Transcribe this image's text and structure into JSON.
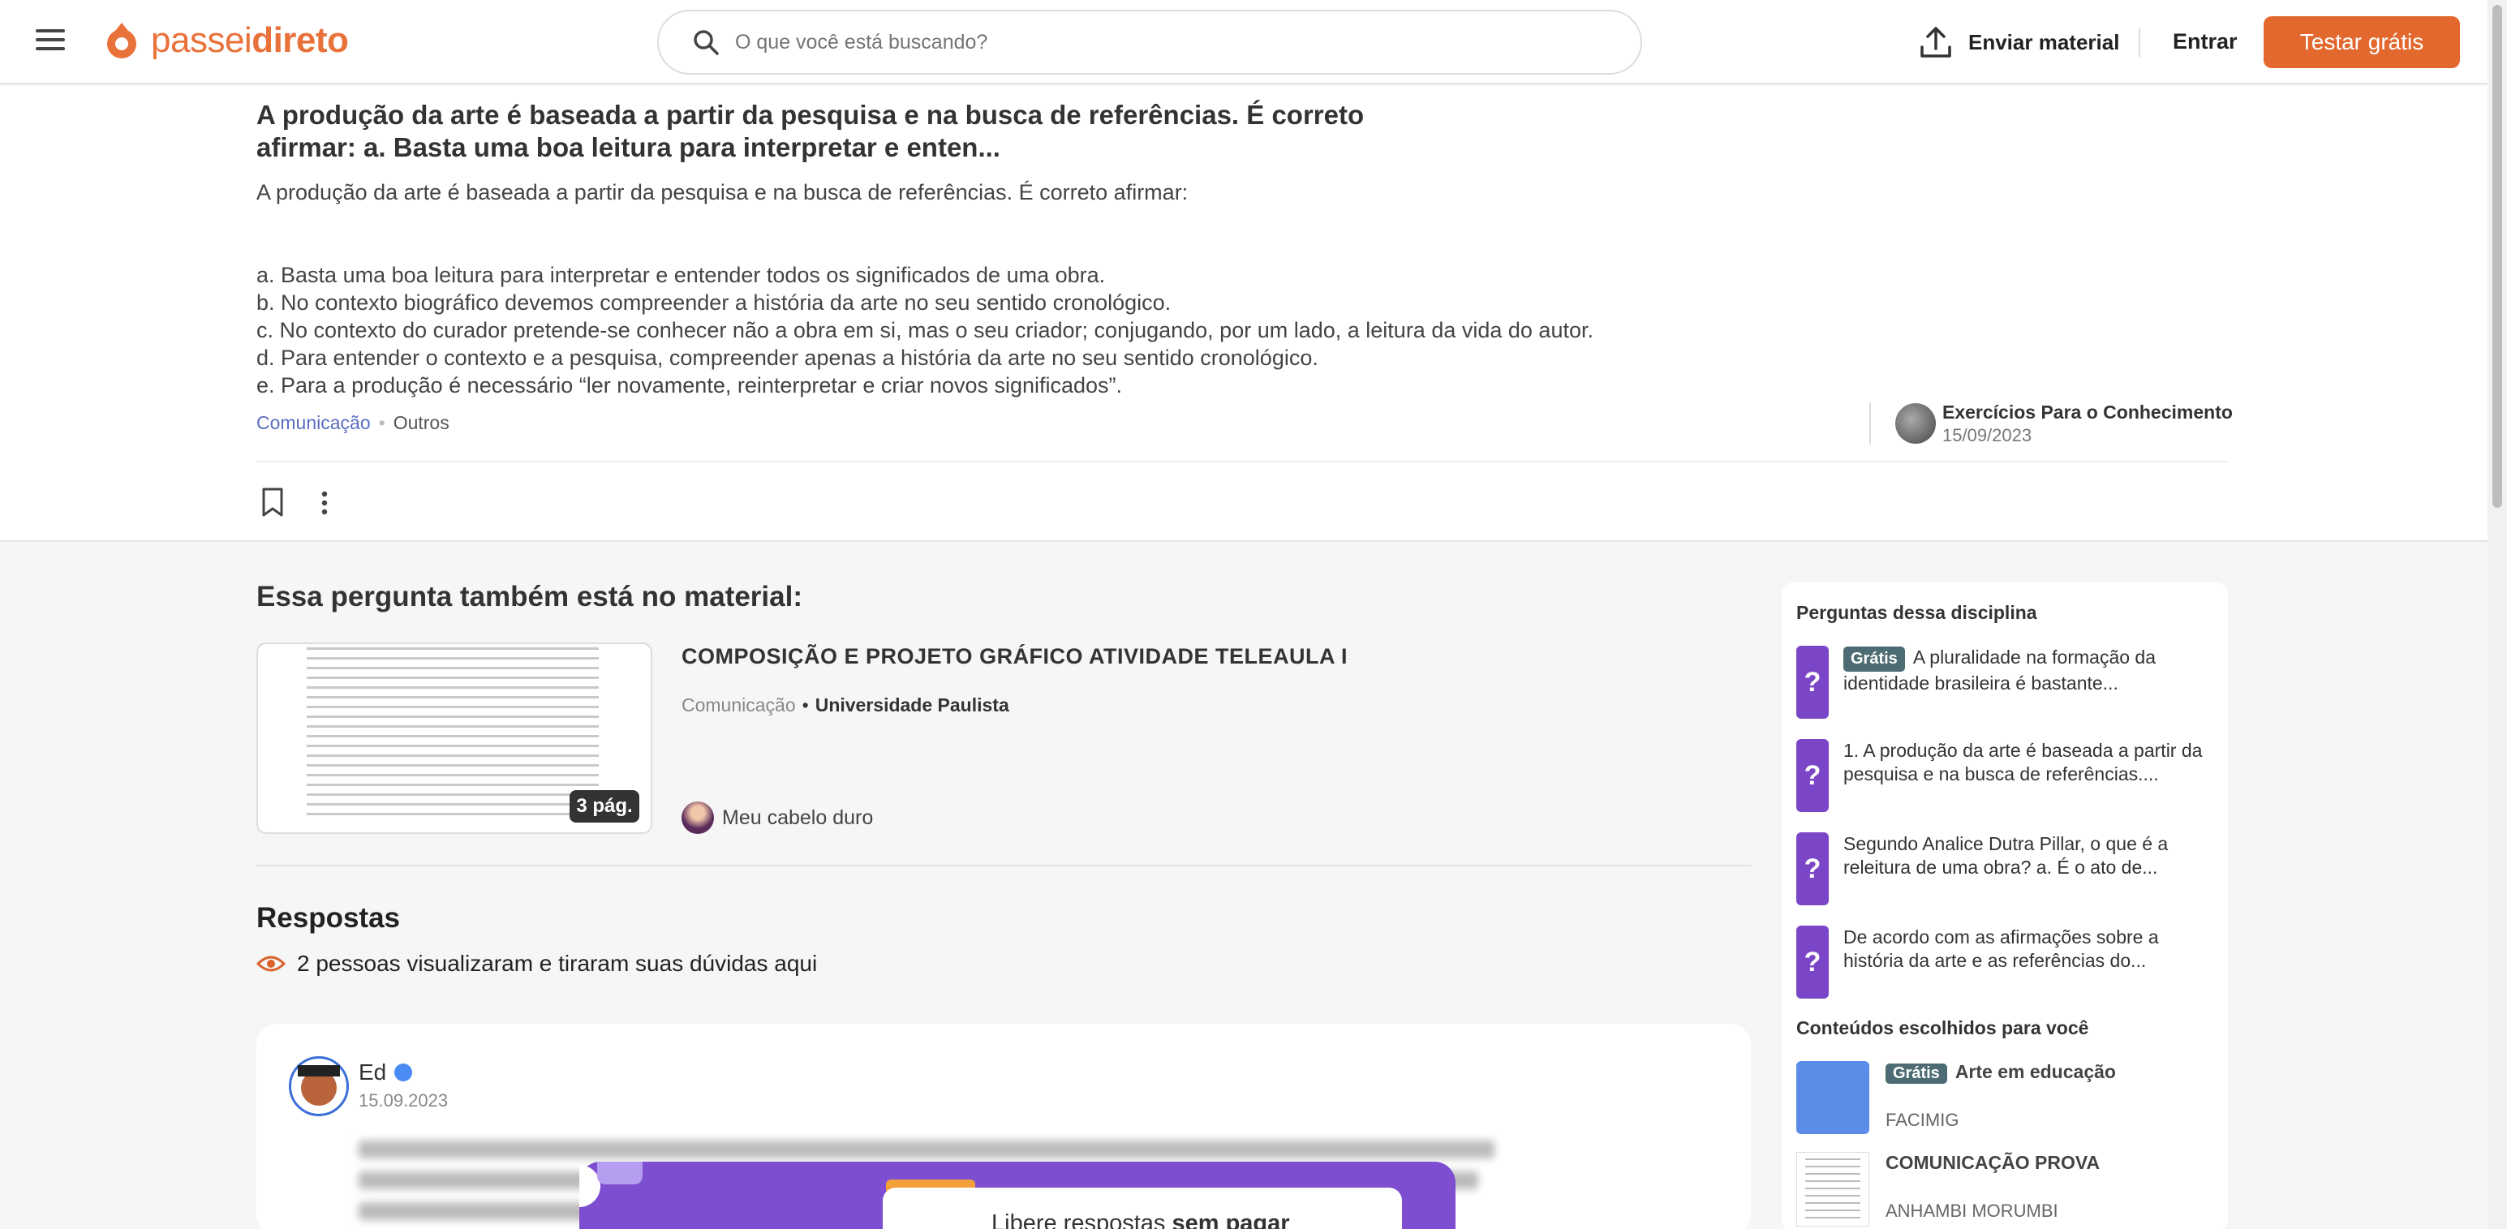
{
  "header": {
    "logo": {
      "part1": "passei",
      "part2": "direto"
    },
    "search_placeholder": "O que você está buscando?",
    "upload_label": "Enviar material",
    "login_label": "Entrar",
    "trial_label": "Testar grátis",
    "accent_color": "#e2682d"
  },
  "question": {
    "title": "A produção da arte é baseada a partir da pesquisa e na busca de referências. É correto afirmar: a. Basta uma boa leitura para interpretar e enten...",
    "intro": "A produção da arte é baseada a partir da pesquisa e na busca de referências. É correto afirmar:",
    "options": [
      "a. Basta uma boa leitura para interpretar e entender todos os significados de uma obra.",
      "b. No contexto biográfico devemos compreender a história da arte no seu sentido cronológico.",
      "c. No contexto do curador pretende-se conhecer não a obra em si, mas o seu criador; conjugando, por um lado, a leitura da vida do autor.",
      "d. Para entender o contexto e a pesquisa, compreender apenas a história da arte no seu sentido cronológico.",
      "e. Para a produção é necessário “ler novamente, reinterpretar e criar novos significados”."
    ],
    "tag_subject": "Comunicação",
    "tag_other": "Outros",
    "author_name": "Exercícios Para o Conhecimento",
    "author_date": "15/09/2023"
  },
  "material": {
    "section_title": "Essa pergunta também está no material:",
    "pages_badge": "3 pág.",
    "title": "COMPOSIÇÃO E PROJETO GRÁFICO ATIVIDADE TELEAULA I",
    "subject": "Comunicação",
    "separator": "•",
    "university": "Universidade Paulista",
    "author": "Meu cabelo duro"
  },
  "answers": {
    "title": "Respostas",
    "views_text": "2 pessoas visualizaram e tiraram suas dúvidas aqui",
    "answer_author": "Ed",
    "answer_date": "15.09.2023",
    "paywall_text_prefix": "Libere respostas ",
    "paywall_text_bold": "sem pagar"
  },
  "sidebar": {
    "questions_heading": "Perguntas dessa disciplina",
    "free_badge": "Grátis",
    "questions": [
      {
        "free": true,
        "text": "A pluralidade na formação da identidade brasileira é bastante..."
      },
      {
        "free": false,
        "text": "1. A produção da arte é baseada a partir da pesquisa e na busca de referências...."
      },
      {
        "free": false,
        "text": "Segundo Analice Dutra Pillar, o que é a releitura de uma obra? a. É o ato de..."
      },
      {
        "free": false,
        "text": "De acordo com as afirmações sobre a história da arte e as referências do..."
      }
    ],
    "content_heading": "Conteúdos escolhidos para você",
    "contents": [
      {
        "free": true,
        "title": "Arte em educação",
        "source": "FACIMIG"
      },
      {
        "free": false,
        "title": "COMUNICAÇÃO PROVA",
        "source": "ANHAMBI MORUMBI"
      }
    ]
  }
}
